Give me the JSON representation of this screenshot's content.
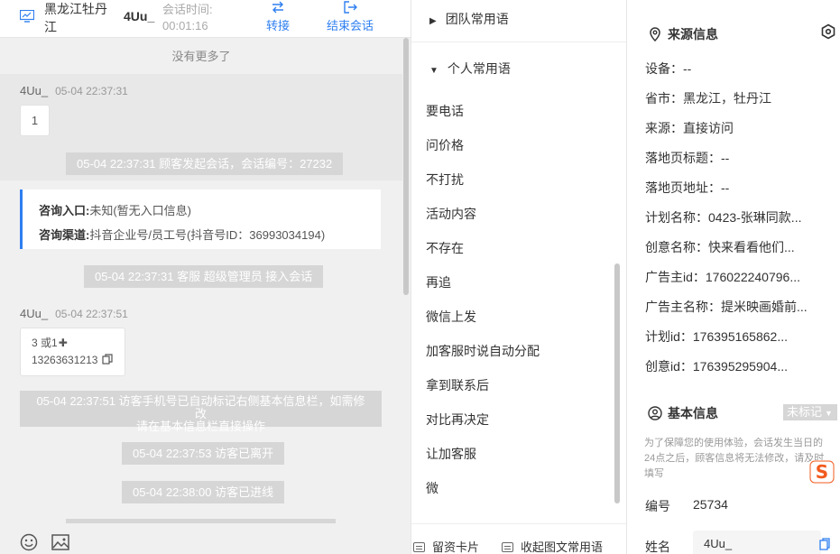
{
  "header": {
    "location": "黑龙江牡丹江",
    "visitor_name": "4Uu_",
    "session_time_label": "会话时间:",
    "session_time_value": "00:01:16",
    "transfer_label": "转接",
    "end_label": "结束会话"
  },
  "chat": {
    "no_more": "没有更多了",
    "msg1_name": "4Uu_",
    "msg1_time": "05-04 22:37:31",
    "msg1_text": "1",
    "sys1": "05-04 22:37:31 顾客发起会话，会话编号：27232",
    "entry_label": "咨询入口:",
    "entry_value": "未知(暂无入口信息)",
    "channel_label": "咨询渠道:",
    "channel_value": "抖音企业号/员工号(抖音号ID：36993034194)",
    "sys2": "05-04 22:37:31 客服 超级管理员 接入会话",
    "msg2_name": "4Uu_",
    "msg2_time": "05-04 22:37:51",
    "msg2_line1": "3 或1",
    "msg2_line2": "13263631213",
    "sys3_line1": "05-04 22:37:51 访客手机号已自动标记右侧基本信息栏，如需修改",
    "sys3_line2": "请在基本信息栏直接操作",
    "sys4": "05-04 22:37:53 访客已离开",
    "sys5": "05-04 22:38:00 访客已进线"
  },
  "phrases": {
    "team_label": "团队常用语",
    "personal_label": "个人常用语",
    "items": [
      "要电话",
      "问价格",
      "不打扰",
      "活动内容",
      "不存在",
      "再追",
      "微信上发",
      "加客服时说自动分配",
      "拿到联系后",
      "对比再决定",
      "让加客服",
      "微"
    ],
    "footer_card": "留资卡片",
    "footer_collapse": "收起图文常用语"
  },
  "side": {
    "source_title": "来源信息",
    "device": "设备：--",
    "province": "省市：黑龙江，牡丹江",
    "source": "来源：直接访问",
    "landing_title": "落地页标题：--",
    "landing_url": "落地页地址：--",
    "plan_name": "计划名称：0423-张琳同款...",
    "creative_name": "创意名称：快来看看他们...",
    "advertiser_id": "广告主id：176022240796...",
    "advertiser_name": "广告主名称：提米映画婚前...",
    "plan_id": "计划id：176395165862...",
    "creative_id": "创意id：176395295904...",
    "basic_title": "基本信息",
    "tag_label": "未标记",
    "notice": "为了保障您的使用体验，会话发生当日的24点之后，顾客信息将无法修改，请及时填写",
    "number_label": "编号",
    "number_value": "25734",
    "name_label": "姓名",
    "name_value": "4Uu_"
  },
  "colors": {
    "accent": "#2f7ff0",
    "system_note": "#d6d6d6",
    "chat_bg": "#f0f0f0"
  }
}
